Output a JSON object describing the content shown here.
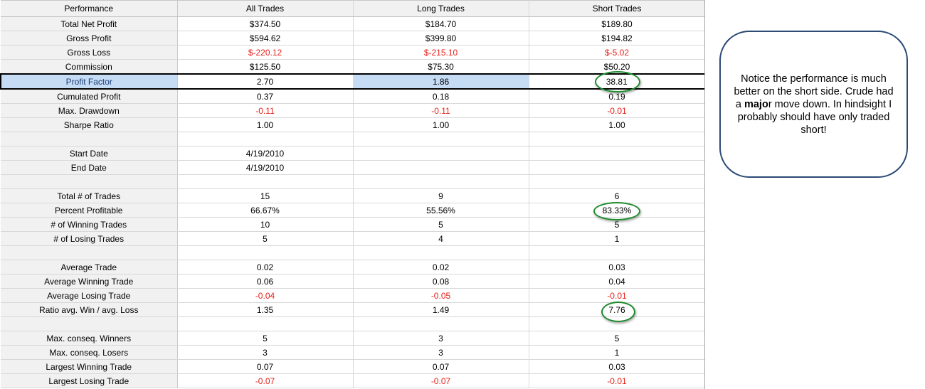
{
  "table": {
    "headers": [
      "Performance",
      "All Trades",
      "Long Trades",
      "Short Trades"
    ],
    "rows": [
      {
        "label": "Total Net Profit",
        "values": [
          "$374.50",
          "$184.70",
          "$189.80"
        ],
        "neg": [
          false,
          false,
          false
        ]
      },
      {
        "label": "Gross Profit",
        "values": [
          "$594.62",
          "$399.80",
          "$194.82"
        ],
        "neg": [
          false,
          false,
          false
        ]
      },
      {
        "label": "Gross Loss",
        "values": [
          "$-220.12",
          "$-215.10",
          "$-5.02"
        ],
        "neg": [
          true,
          true,
          true
        ]
      },
      {
        "label": "Commission",
        "values": [
          "$125.50",
          "$75.30",
          "$50.20"
        ],
        "neg": [
          false,
          false,
          false
        ]
      },
      {
        "label": "Profit Factor",
        "values": [
          "2.70",
          "1.86",
          "38.81"
        ],
        "neg": [
          false,
          false,
          false
        ],
        "selected": true
      },
      {
        "label": "Cumulated Profit",
        "values": [
          "0.37",
          "0.18",
          "0.19"
        ],
        "neg": [
          false,
          false,
          false
        ]
      },
      {
        "label": "Max. Drawdown",
        "values": [
          "-0.11",
          "-0.11",
          "-0.01"
        ],
        "neg": [
          true,
          true,
          true
        ]
      },
      {
        "label": "Sharpe Ratio",
        "values": [
          "1.00",
          "1.00",
          "1.00"
        ],
        "neg": [
          false,
          false,
          false
        ]
      },
      {
        "label": "",
        "values": [
          "",
          "",
          ""
        ],
        "neg": [
          false,
          false,
          false
        ]
      },
      {
        "label": "Start Date",
        "values": [
          "4/19/2010",
          "",
          ""
        ],
        "neg": [
          false,
          false,
          false
        ]
      },
      {
        "label": "End Date",
        "values": [
          "4/19/2010",
          "",
          ""
        ],
        "neg": [
          false,
          false,
          false
        ]
      },
      {
        "label": "",
        "values": [
          "",
          "",
          ""
        ],
        "neg": [
          false,
          false,
          false
        ]
      },
      {
        "label": "Total # of Trades",
        "values": [
          "15",
          "9",
          "6"
        ],
        "neg": [
          false,
          false,
          false
        ]
      },
      {
        "label": "Percent Profitable",
        "values": [
          "66.67%",
          "55.56%",
          "83.33%"
        ],
        "neg": [
          false,
          false,
          false
        ]
      },
      {
        "label": "# of Winning Trades",
        "values": [
          "10",
          "5",
          "5"
        ],
        "neg": [
          false,
          false,
          false
        ]
      },
      {
        "label": "# of Losing Trades",
        "values": [
          "5",
          "4",
          "1"
        ],
        "neg": [
          false,
          false,
          false
        ]
      },
      {
        "label": "",
        "values": [
          "",
          "",
          ""
        ],
        "neg": [
          false,
          false,
          false
        ]
      },
      {
        "label": "Average Trade",
        "values": [
          "0.02",
          "0.02",
          "0.03"
        ],
        "neg": [
          false,
          false,
          false
        ]
      },
      {
        "label": "Average Winning Trade",
        "values": [
          "0.06",
          "0.08",
          "0.04"
        ],
        "neg": [
          false,
          false,
          false
        ]
      },
      {
        "label": "Average Losing Trade",
        "values": [
          "-0.04",
          "-0.05",
          "-0.01"
        ],
        "neg": [
          true,
          true,
          true
        ]
      },
      {
        "label": "Ratio avg. Win / avg. Loss",
        "values": [
          "1.35",
          "1.49",
          "7.76"
        ],
        "neg": [
          false,
          false,
          false
        ]
      },
      {
        "label": "",
        "values": [
          "",
          "",
          ""
        ],
        "neg": [
          false,
          false,
          false
        ]
      },
      {
        "label": "Max. conseq. Winners",
        "values": [
          "5",
          "3",
          "5"
        ],
        "neg": [
          false,
          false,
          false
        ]
      },
      {
        "label": "Max. conseq. Losers",
        "values": [
          "3",
          "3",
          "1"
        ],
        "neg": [
          false,
          false,
          false
        ]
      },
      {
        "label": "Largest Winning Trade",
        "values": [
          "0.07",
          "0.07",
          "0.03"
        ],
        "neg": [
          false,
          false,
          false
        ]
      },
      {
        "label": "Largest Losing Trade",
        "values": [
          "-0.07",
          "-0.07",
          "-0.01"
        ],
        "neg": [
          true,
          true,
          true
        ]
      }
    ]
  },
  "callout": {
    "text_before": "Notice the performance is much better on the short side.  Crude had a ",
    "text_bold": "majo",
    "text_after": "r move down.  In hindsight I probably should have only traded short!"
  },
  "colors": {
    "negative": "#e8201a",
    "selection": "#c6dcf5",
    "annotation_circle": "#1e8a2c",
    "callout_border": "#2b4a74"
  }
}
